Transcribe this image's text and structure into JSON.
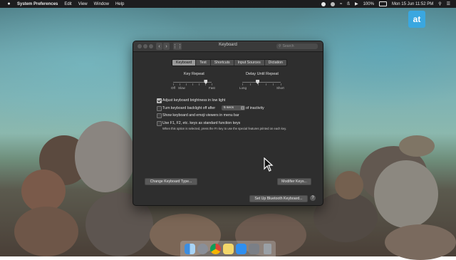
{
  "menubar": {
    "app_name": "System Preferences",
    "items": [
      "Edit",
      "View",
      "Window",
      "Help"
    ],
    "battery": "100%",
    "datetime": "Mon 15 Jun  11:52 PM"
  },
  "logo": {
    "text": "at"
  },
  "window": {
    "title": "Keyboard",
    "search_placeholder": "Search",
    "tabs": [
      "Keyboard",
      "Text",
      "Shortcuts",
      "Input Sources",
      "Dictation"
    ],
    "active_tab": "Keyboard",
    "key_repeat": {
      "label": "Key Repeat",
      "min_labels": [
        "Off",
        "Slow"
      ],
      "max_label": "Fast",
      "value_fraction": 0.85
    },
    "delay_until_repeat": {
      "label": "Delay Until Repeat",
      "min_label": "Long",
      "max_label": "Short",
      "value_fraction": 0.4
    },
    "options": {
      "brightness": {
        "label": "Adjust keyboard brightness in low light",
        "checked": true
      },
      "backlight_off": {
        "label_pre": "Turn keyboard backlight off after",
        "select_value": "5 secs",
        "label_post": "of inactivity",
        "checked": false
      },
      "viewers": {
        "label": "Show keyboard and emoji viewers in menu bar",
        "checked": false
      },
      "fkeys": {
        "label": "Use F1, F2, etc. keys as standard function keys",
        "note": "When this option is selected, press the Fn key to use the special features printed on each key.",
        "checked": false
      }
    },
    "buttons": {
      "change_type": "Change Keyboard Type...",
      "modifier": "Modifier Keys...",
      "bluetooth": "Set Up Bluetooth Keyboard...",
      "help": "?"
    }
  },
  "colors": {
    "accent_logo": "#3aa7e0",
    "window_bg": "#2e2e2e"
  },
  "dock": {
    "icons": [
      "finder-icon",
      "launchpad-icon",
      "chrome-icon",
      "notes-icon",
      "app-store-icon",
      "system-preferences-icon",
      "trash-icon"
    ]
  }
}
